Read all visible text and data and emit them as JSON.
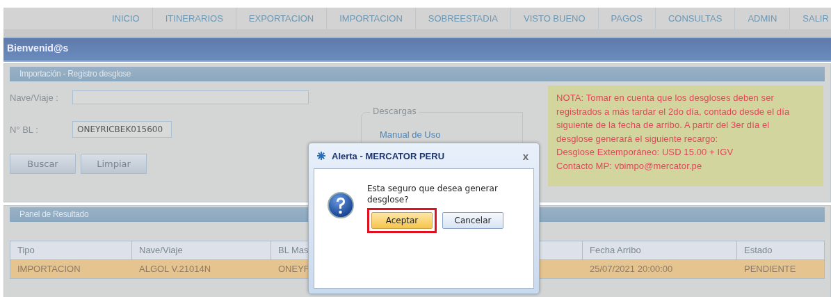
{
  "nav": [
    "INICIO",
    "ITINERARIOS",
    "EXPORTACION",
    "IMPORTACION",
    "SOBREESTADIA",
    "VISTO BUENO",
    "PAGOS",
    "CONSULTAS",
    "ADMIN",
    "SALIR"
  ],
  "welcome": "Bienvenid@s",
  "form_panel": {
    "title": "Importación - Registro desglose",
    "fields": [
      {
        "label": "Nave/Viaje :"
      },
      {
        "label": "N° BL :",
        "value": "ONEYRICBEK015600"
      }
    ],
    "buttons": [
      "Buscar",
      "Limpiar"
    ],
    "downloads": {
      "legend": "Descargas",
      "link": "Manual de Uso"
    },
    "note": [
      "NOTA: Tomar en cuenta que los desgloses deben ser registrados a más tardar el 2do día, contado desde el día siguiente de la fecha de arribo. A partir del 3er día el desglose generará el siguiente recargo:",
      "Desglose Extemporáneo: USD 15.00 + IGV",
      "Contacto MP: vbimpo@mercator.pe"
    ]
  },
  "results_panel": {
    "title": "Panel de Resultado",
    "columns": [
      "Tipo",
      "Nave/Viaje",
      "BL Mas",
      "Fecha Arribo",
      "Estado"
    ],
    "rows": [
      {
        "cells": [
          "IMPORTACION",
          "ALGOL V.21014N",
          "ONEYF",
          "25/07/2021 20:00:00",
          "PENDIENTE"
        ],
        "selected": true
      }
    ]
  },
  "dialog": {
    "title": "Alerta - MERCATOR PERU",
    "close": "x",
    "message": "Esta seguro que desea generar desglose?",
    "buttons": [
      {
        "label": "Aceptar",
        "kind": "primary",
        "highlighted": true
      },
      {
        "label": "Cancelar",
        "kind": "secondary",
        "highlighted": false
      }
    ]
  }
}
